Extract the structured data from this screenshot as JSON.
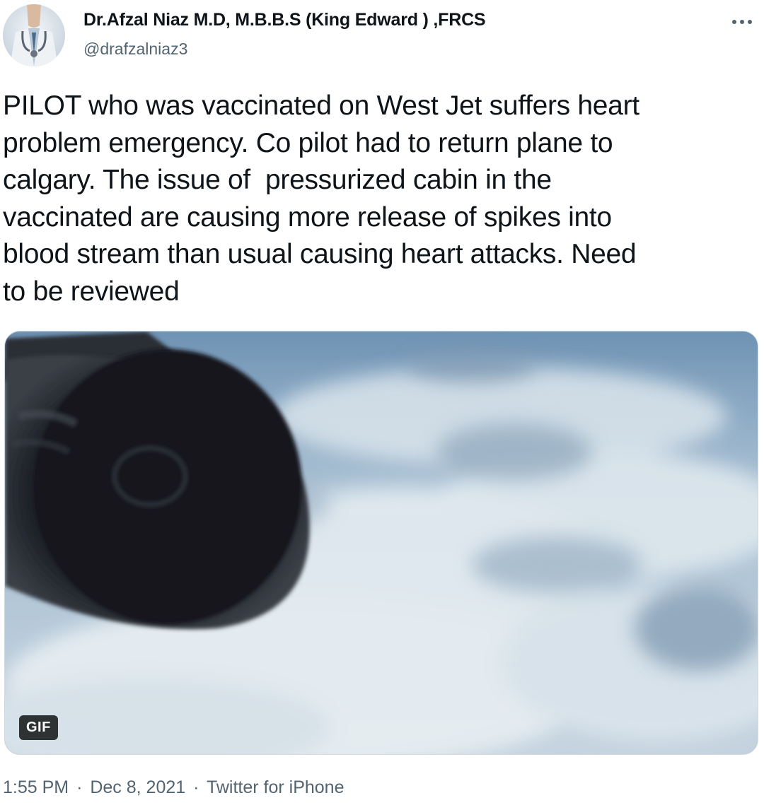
{
  "author": {
    "display_name": "Dr.Afzal Niaz M.D, M.B.B.S (King Edward ) ,FRCS",
    "handle": "@drafzalniaz3",
    "avatar_icon": "doctor-avatar"
  },
  "more_icon": "ellipsis-icon",
  "tweet": {
    "text": "PILOT who was vaccinated on West Jet suffers heart\nproblem emergency. Co pilot had to return plane to\ncalgary. The issue of  pressurized cabin in the\nvaccinated are causing more release of spikes into\nblood stream than usual causing heart attacks. Need\nto be reviewed"
  },
  "media": {
    "badge": "GIF"
  },
  "meta": {
    "time": "1:55 PM",
    "separator": "·",
    "date": "Dec 8, 2021",
    "source": "Twitter for iPhone"
  },
  "colors": {
    "text": "#0f1419",
    "secondary": "#536471",
    "border": "#cfd9de"
  }
}
